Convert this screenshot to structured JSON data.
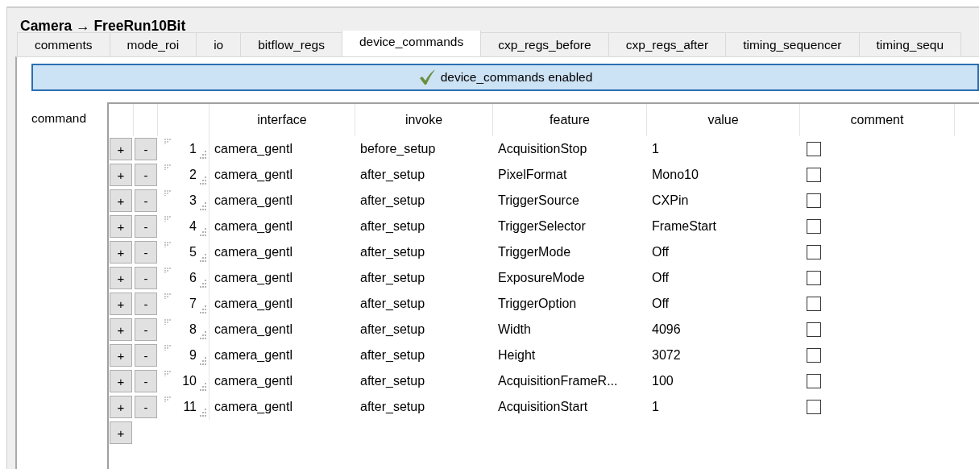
{
  "breadcrumb": "Camera → FreeRun10Bit",
  "tabs": [
    {
      "label": "comments",
      "selected": false
    },
    {
      "label": "mode_roi",
      "selected": false
    },
    {
      "label": "io",
      "selected": false
    },
    {
      "label": "bitflow_regs",
      "selected": false
    },
    {
      "label": "device_commands",
      "selected": true
    },
    {
      "label": "cxp_regs_before",
      "selected": false
    },
    {
      "label": "cxp_regs_after",
      "selected": false
    },
    {
      "label": "timing_sequencer",
      "selected": false
    },
    {
      "label": "timing_sequ",
      "selected": false
    }
  ],
  "banner": {
    "text": "device_commands enabled",
    "enabled": true
  },
  "field_label": "command",
  "table": {
    "columns": [
      "interface",
      "invoke",
      "feature",
      "value",
      "comment"
    ],
    "rows": [
      {
        "add": "+",
        "remove": "-",
        "index": "1",
        "interface": "camera_gentl",
        "invoke": "before_setup",
        "feature": "AcquisitionStop",
        "value": "1",
        "comment_checked": false
      },
      {
        "add": "+",
        "remove": "-",
        "index": "2",
        "interface": "camera_gentl",
        "invoke": "after_setup",
        "feature": "PixelFormat",
        "value": "Mono10",
        "comment_checked": false
      },
      {
        "add": "+",
        "remove": "-",
        "index": "3",
        "interface": "camera_gentl",
        "invoke": "after_setup",
        "feature": "TriggerSource",
        "value": "CXPin",
        "comment_checked": false
      },
      {
        "add": "+",
        "remove": "-",
        "index": "4",
        "interface": "camera_gentl",
        "invoke": "after_setup",
        "feature": "TriggerSelector",
        "value": "FrameStart",
        "comment_checked": false
      },
      {
        "add": "+",
        "remove": "-",
        "index": "5",
        "interface": "camera_gentl",
        "invoke": "after_setup",
        "feature": "TriggerMode",
        "value": "Off",
        "comment_checked": false
      },
      {
        "add": "+",
        "remove": "-",
        "index": "6",
        "interface": "camera_gentl",
        "invoke": "after_setup",
        "feature": "ExposureMode",
        "value": "Off",
        "comment_checked": false
      },
      {
        "add": "+",
        "remove": "-",
        "index": "7",
        "interface": "camera_gentl",
        "invoke": "after_setup",
        "feature": "TriggerOption",
        "value": "Off",
        "comment_checked": false
      },
      {
        "add": "+",
        "remove": "-",
        "index": "8",
        "interface": "camera_gentl",
        "invoke": "after_setup",
        "feature": "Width",
        "value": "4096",
        "comment_checked": false
      },
      {
        "add": "+",
        "remove": "-",
        "index": "9",
        "interface": "camera_gentl",
        "invoke": "after_setup",
        "feature": "Height",
        "value": "3072",
        "comment_checked": false
      },
      {
        "add": "+",
        "remove": "-",
        "index": "10",
        "interface": "camera_gentl",
        "invoke": "after_setup",
        "feature": "AcquisitionFrameR...",
        "value": "100",
        "comment_checked": false
      },
      {
        "add": "+",
        "remove": "-",
        "index": "11",
        "interface": "camera_gentl",
        "invoke": "after_setup",
        "feature": "AcquisitionStart",
        "value": "1",
        "comment_checked": false
      }
    ],
    "add_row": "+"
  }
}
